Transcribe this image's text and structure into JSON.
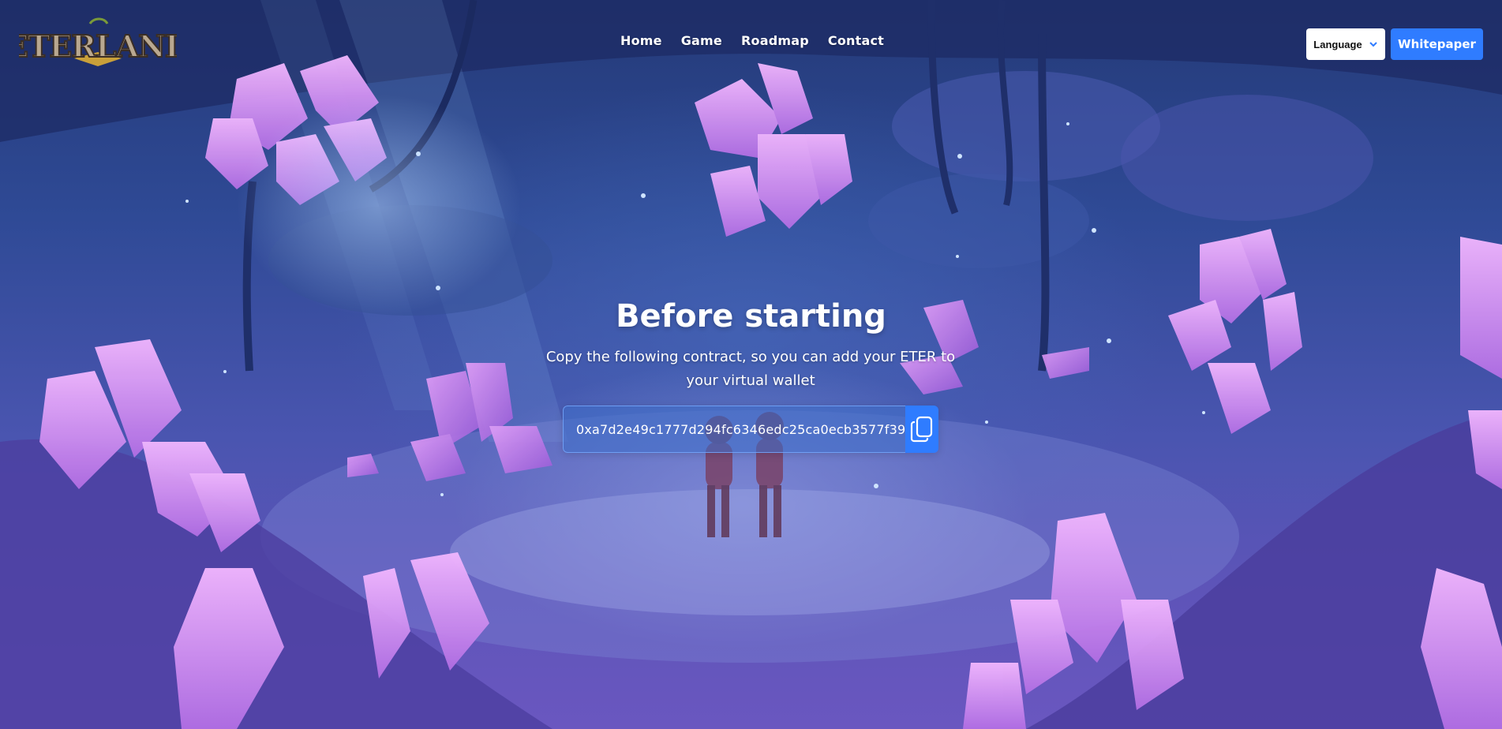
{
  "header": {
    "logo_text": "ETERLAND",
    "nav": [
      "Home",
      "Game",
      "Roadmap",
      "Contact"
    ],
    "language_label": "Language",
    "whitepaper_label": "Whitepaper"
  },
  "main": {
    "title": "Before starting",
    "subtitle": "Copy the following contract, so you can add your ETER to your virtual wallet",
    "contract_address": "0xa7d2e49c1777d294fc6346edc25ca0ecb3577f39"
  },
  "colors": {
    "accent": "#2f7cff",
    "background": "#3c3a8e",
    "crystal": "#d78ff0"
  },
  "icons": {
    "copy": "copy-icon",
    "language_dropdown": "chevron-down-icon"
  }
}
